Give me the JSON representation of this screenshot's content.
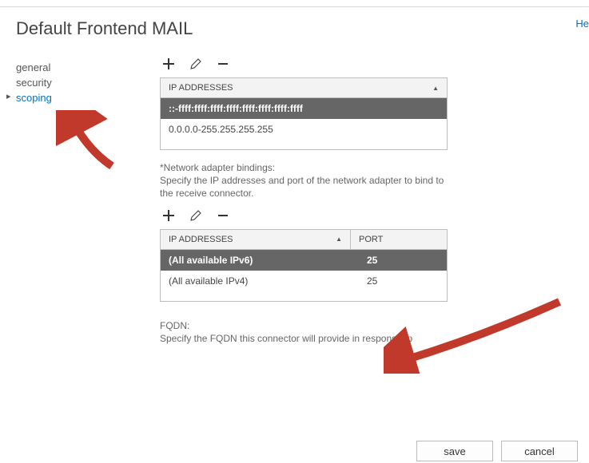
{
  "help_link": "He",
  "page_title": "Default Frontend MAIL",
  "sidebar": {
    "items": [
      {
        "label": "general"
      },
      {
        "label": "security"
      },
      {
        "label": "scoping"
      }
    ]
  },
  "remote_ip": {
    "header": "IP ADDRESSES",
    "rows": [
      "::-ffff:ffff:ffff:ffff:ffff:ffff:ffff:ffff",
      "0.0.0.0-255.255.255.255"
    ]
  },
  "bindings_note_title": "*Network adapter bindings:",
  "bindings_note_body": "Specify the IP addresses and port of the network adapter to bind to the receive connector.",
  "bindings": {
    "header_ip": "IP ADDRESSES",
    "header_port": "PORT",
    "rows": [
      {
        "ip": "(All available IPv6)",
        "port": "25"
      },
      {
        "ip": "(All available IPv4)",
        "port": "25"
      }
    ]
  },
  "fqdn_label": "FQDN:",
  "fqdn_help": "Specify the FQDN this connector will provide in response to",
  "buttons": {
    "save": "save",
    "cancel": "cancel"
  }
}
